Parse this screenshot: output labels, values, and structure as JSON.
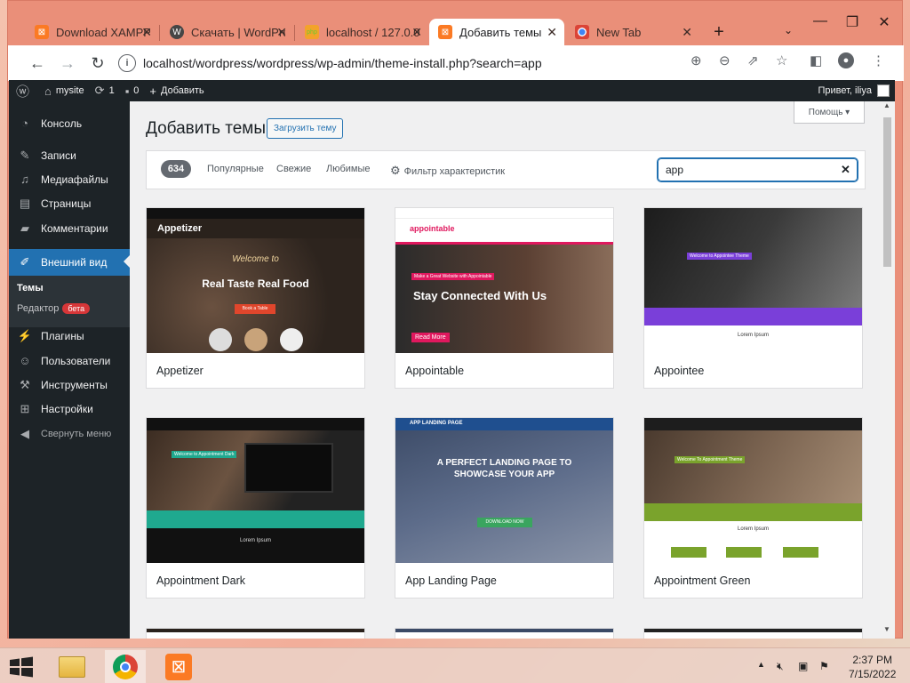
{
  "browser": {
    "tabs": [
      {
        "label": "Download XAMPP",
        "icon": "xampp-icon"
      },
      {
        "label": "Скачать | WordPress",
        "icon": "wordpress-icon"
      },
      {
        "label": "localhost / 127.0.0.1",
        "icon": "phpmyadmin-icon"
      },
      {
        "label": "Добавить темы",
        "icon": "xampp-icon"
      },
      {
        "label": "New Tab",
        "icon": "chrome-icon"
      }
    ],
    "url": "localhost/wordpress/wordpress/wp-admin/theme-install.php?search=app"
  },
  "wp_admin_bar": {
    "site_name": "mysite",
    "updates_count": "1",
    "comments_count": "0",
    "add_new": "Добавить",
    "greeting": "Привет, iliya"
  },
  "sidebar": {
    "items": [
      {
        "label": "Консоль",
        "icon": "dashboard-icon"
      },
      {
        "label": "Записи",
        "icon": "pin-icon"
      },
      {
        "label": "Медиафайлы",
        "icon": "media-icon"
      },
      {
        "label": "Страницы",
        "icon": "pages-icon"
      },
      {
        "label": "Комментарии",
        "icon": "comments-icon"
      },
      {
        "label": "Внешний вид",
        "icon": "appearance-icon"
      },
      {
        "label": "Плагины",
        "icon": "plugins-icon"
      },
      {
        "label": "Пользователи",
        "icon": "users-icon"
      },
      {
        "label": "Инструменты",
        "icon": "tools-icon"
      },
      {
        "label": "Настройки",
        "icon": "settings-icon"
      }
    ],
    "submenu": {
      "themes": "Темы",
      "editor": "Редактор",
      "editor_badge": "бета"
    },
    "collapse": "Свернуть меню"
  },
  "main": {
    "title": "Добавить темы",
    "upload_button": "Загрузить тему",
    "help_button": "Помощь",
    "theme_count": "634",
    "filter_tabs": [
      "Популярные",
      "Свежие",
      "Любимые"
    ],
    "feature_filter": "Фильтр характеристик",
    "search_value": "app"
  },
  "themes": [
    {
      "name": "Appetizer",
      "heading": "Real Taste Real Food",
      "script": "Welcome to",
      "brand": "Appetizer",
      "cta": "Book a Table"
    },
    {
      "name": "Appointable",
      "heading": "Stay Connected With Us",
      "brand": "appointable",
      "cta": "Read More",
      "tag": "Make a Great Website with Appointable"
    },
    {
      "name": "Appointee",
      "heading": "Welcome to Appointee Theme",
      "footer": "Lorem Ipsum"
    },
    {
      "name": "Appointment Dark",
      "heading": "Welcome to Appointment Dark",
      "footer": "Lorem Ipsum"
    },
    {
      "name": "App Landing Page",
      "heading": "A PERFECT LANDING PAGE TO SHOWCASE YOUR APP",
      "brand": "APP LANDING PAGE",
      "cta": "DOWNLOAD NOW"
    },
    {
      "name": "Appointment Green",
      "heading": "Welcome To Appointment Theme",
      "footer": "Lorem Ipsum"
    }
  ],
  "taskbar": {
    "time": "2:37 PM",
    "date": "7/15/2022"
  }
}
